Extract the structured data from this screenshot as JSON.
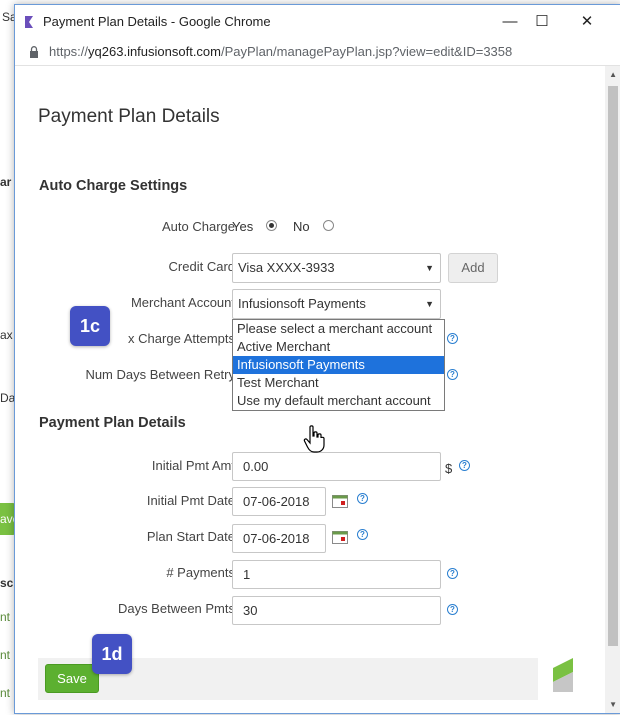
{
  "window": {
    "title": "Payment Plan Details - Google Chrome",
    "minimize": "—",
    "maximize": "☐",
    "close": "✕"
  },
  "address_bar": {
    "prefix": "https://",
    "host": "yq263.infusionsoft.com",
    "path": "/PayPlan/managePayPlan.jsp?view=edit&ID=3358"
  },
  "background_page": {
    "fragments": [
      "Sa",
      "ar",
      "ax",
      "Da",
      "ave",
      "sc",
      "nt",
      "nt",
      "nt"
    ]
  },
  "page_title": "Payment Plan Details",
  "auto_charge": {
    "section_title": "Auto Charge Settings",
    "auto_charge_label": "Auto Charge",
    "yes_label": "Yes",
    "no_label": "No",
    "yes_selected": true,
    "credit_card_label": "Credit Card",
    "credit_card_value": "Visa XXXX-3933",
    "add_label": "Add",
    "merchant_label": "Merchant Account",
    "merchant_value": "Infusionsoft Payments",
    "max_attempts_label": "x Charge Attempts",
    "num_days_label": "Num Days Between Retry",
    "merchant_options": [
      "Please select a merchant account",
      "Active Merchant",
      "Infusionsoft Payments",
      "Test Merchant",
      "Use my default merchant account"
    ],
    "highlighted_option": "Infusionsoft Payments"
  },
  "plan_details": {
    "section_title": "Payment Plan Details",
    "initial_amt_label": "Initial Pmt Amt",
    "initial_amt_value": "0.00",
    "currency": "$",
    "initial_date_label": "Initial Pmt Date",
    "initial_date_value": "07-06-2018",
    "start_date_label": "Plan Start Date",
    "start_date_value": "07-06-2018",
    "num_payments_label": "# Payments",
    "num_payments_value": "1",
    "days_between_label": "Days Between Pmts",
    "days_between_value": "30"
  },
  "footer": {
    "save_label": "Save"
  },
  "callouts": [
    "1c",
    "1d"
  ],
  "colors": {
    "accent": "#1e72dc",
    "save_button": "#5cb030",
    "callout": "#4351c4",
    "help_icon": "#2a7fd0"
  },
  "icons": [
    "app-icon",
    "lock-icon",
    "help-icon",
    "calendar-icon",
    "hand-cursor-icon",
    "brand-logo-icon"
  ]
}
